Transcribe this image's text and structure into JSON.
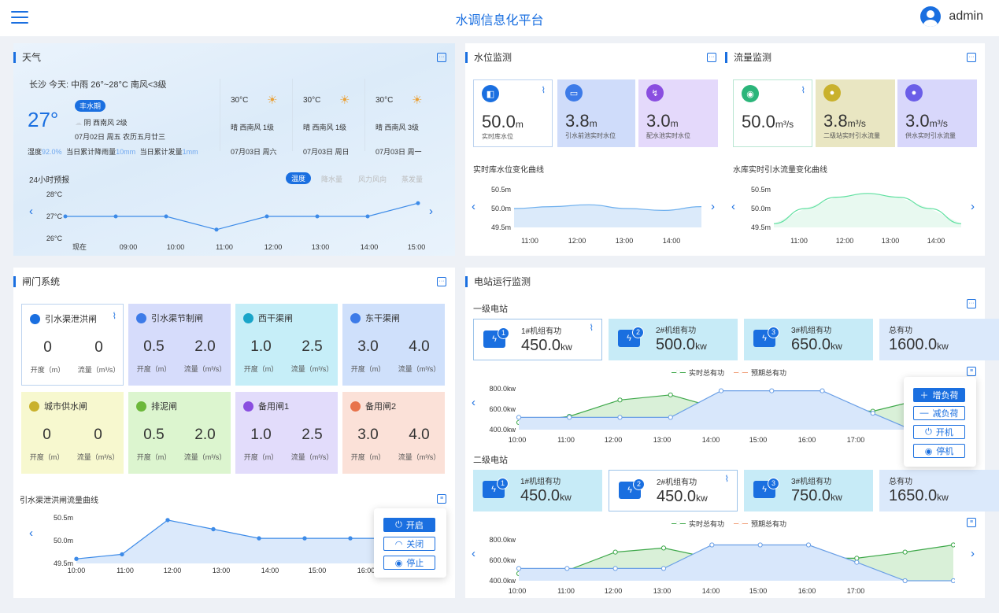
{
  "header": {
    "title": "水调信息化平台",
    "user": "admin"
  },
  "weather": {
    "title": "天气",
    "summary": "长沙 今天: 中雨 26°~28°C 南风<3级",
    "temp": "27°",
    "tag": "丰水期",
    "cond": "阴 西南风 2级",
    "date": "07月02日 周五 农历五月廿三",
    "humidity_label": "湿度",
    "humidity": "92.0%",
    "rain_label": "当日累计降雨量",
    "rain": "10mm",
    "evap_label": "当日累计发量",
    "evap": "1mm",
    "forecast": [
      {
        "temp": "30°C",
        "desc": "晴 西南风 1级",
        "date": "07月03日 周六"
      },
      {
        "temp": "30°C",
        "desc": "晴 西南风 1级",
        "date": "07月03日 周日"
      },
      {
        "temp": "30°C",
        "desc": "晴 西南风 3级",
        "date": "07月03日 周一"
      }
    ],
    "hourly_title": "24小时预报",
    "chips": [
      "温度",
      "降水量",
      "风力风向",
      "蒸发量"
    ]
  },
  "water_level": {
    "title": "水位监测",
    "cards": [
      {
        "value": "50.0",
        "unit": "m",
        "label": "实时库水位",
        "color": "#1a6fe0"
      },
      {
        "value": "3.8",
        "unit": "m",
        "label": "引水前池实时水位",
        "color": "#3d7be8"
      },
      {
        "value": "3.0",
        "unit": "m",
        "label": "配水池实时水位",
        "color": "#8a4ee0"
      }
    ],
    "chart_title": "实时库水位变化曲线"
  },
  "flow": {
    "title": "流量监测",
    "cards": [
      {
        "value": "50.0",
        "unit": "m³/s",
        "label": "",
        "color": "#2bb57a"
      },
      {
        "value": "3.8",
        "unit": "m³/s",
        "label": "二级站实时引水流量",
        "color": "#c9b12c"
      },
      {
        "value": "3.0",
        "unit": "m³/s",
        "label": "供水实时引水流量",
        "color": "#6b5ee8"
      }
    ],
    "chart_title": "水库实时引水流量变化曲线"
  },
  "gates": {
    "title": "闸门系统",
    "items": [
      {
        "name": "引水渠泄洪闸",
        "open": "0",
        "flow": "0",
        "color": "#1a6fe0"
      },
      {
        "name": "引水渠节制闸",
        "open": "0.5",
        "flow": "2.0",
        "color": "#3d7be8"
      },
      {
        "name": "西干渠闸",
        "open": "1.0",
        "flow": "2.5",
        "color": "#1aa5c9"
      },
      {
        "name": "东干渠闸",
        "open": "3.0",
        "flow": "4.0",
        "color": "#3d7be8"
      },
      {
        "name": "城市供水闸",
        "open": "0",
        "flow": "0",
        "color": "#c9b12c"
      },
      {
        "name": "排泥闸",
        "open": "0.5",
        "flow": "2.0",
        "color": "#6cb83a"
      },
      {
        "name": "备用闸1",
        "open": "1.0",
        "flow": "2.5",
        "color": "#8a4ee0"
      },
      {
        "name": "备用闸2",
        "open": "3.0",
        "flow": "4.0",
        "color": "#e8734b"
      }
    ],
    "open_label": "开度（m）",
    "flow_label": "流量（m³/s）",
    "chart_title": "引水渠泄洪闸流量曲线",
    "popup": [
      "开启",
      "关闭",
      "停止"
    ]
  },
  "power": {
    "title": "电站运行监测",
    "station1": {
      "title": "一级电站",
      "units": [
        {
          "name": "1#机组有功",
          "value": "450.0",
          "num": "1"
        },
        {
          "name": "2#机组有功",
          "value": "500.0",
          "num": "2"
        },
        {
          "name": "3#机组有功",
          "value": "650.0",
          "num": "3"
        },
        {
          "name": "总有功",
          "value": "1600.0",
          "num": ""
        }
      ]
    },
    "station2": {
      "title": "二级电站",
      "units": [
        {
          "name": "1#机组有功",
          "value": "450.0",
          "num": "1"
        },
        {
          "name": "2#机组有功",
          "value": "450.0",
          "num": "2"
        },
        {
          "name": "3#机组有功",
          "value": "750.0",
          "num": "3"
        },
        {
          "name": "总有功",
          "value": "1650.0",
          "num": ""
        }
      ]
    },
    "unit": "kw",
    "legend": [
      "实时总有功",
      "预期总有功"
    ],
    "popup": [
      "增负荷",
      "减负荷",
      "开机",
      "停机"
    ]
  },
  "chart_data": [
    {
      "type": "line",
      "title": "",
      "x": [
        "现在",
        "09:00",
        "10:00",
        "11:00",
        "12:00",
        "13:00",
        "14:00",
        "15:00"
      ],
      "series": [
        {
          "values": [
            27,
            27,
            27,
            26.4,
            27,
            27,
            27,
            27.6
          ]
        }
      ],
      "yticks": [
        "28°C",
        "27°C",
        "26°C"
      ],
      "ylim": [
        26,
        28
      ]
    },
    {
      "type": "area",
      "title": "实时库水位变化曲线",
      "x": [
        "11:00",
        "12:00",
        "13:00",
        "14:00"
      ],
      "series": [
        {
          "values": [
            50.0,
            50.05,
            50.1,
            50.0,
            49.95,
            50.05
          ]
        }
      ],
      "yticks": [
        "50.5m",
        "50.0m",
        "49.5m"
      ],
      "ylim": [
        49.5,
        50.5
      ]
    },
    {
      "type": "area",
      "title": "水库实时引水流量变化曲线",
      "x": [
        "11:00",
        "12:00",
        "13:00",
        "14:00"
      ],
      "series": [
        {
          "values": [
            49.6,
            50.0,
            50.3,
            50.4,
            50.3,
            50.0,
            49.6
          ]
        }
      ],
      "yticks": [
        "50.5m",
        "50.0m",
        "49.5m"
      ],
      "ylim": [
        49.5,
        50.5
      ]
    },
    {
      "type": "area",
      "title": "引水渠泄洪闸流量曲线",
      "x": [
        "10:00",
        "11:00",
        "12:00",
        "13:00",
        "14:00",
        "15:00",
        "16:00"
      ],
      "series": [
        {
          "values": [
            49.6,
            49.7,
            50.45,
            50.25,
            50.05,
            50.05,
            50.05,
            50.05
          ]
        }
      ],
      "yticks": [
        "50.5m",
        "50.0m",
        "49.5m"
      ],
      "ylim": [
        49.5,
        50.5
      ]
    },
    {
      "type": "line",
      "title": "",
      "x": [
        "10:00",
        "11:00",
        "12:00",
        "13:00",
        "14:00",
        "15:00",
        "16:00",
        "17:00"
      ],
      "series": [
        {
          "name": "实时总有功",
          "values": [
            470,
            530,
            690,
            740,
            600,
            600,
            600,
            580,
            700
          ]
        },
        {
          "name": "预期总有功",
          "values": [
            520,
            520,
            520,
            520,
            780,
            780,
            780,
            560,
            350
          ]
        }
      ],
      "yticks": [
        "800.0kw",
        "600.0kw",
        "400.0kw"
      ],
      "ylim": [
        400,
        800
      ]
    },
    {
      "type": "line",
      "title": "",
      "x": [
        "10:00",
        "11:00",
        "12:00",
        "13:00",
        "14:00",
        "15:00",
        "16:00",
        "17:00"
      ],
      "series": [
        {
          "name": "实时总有功",
          "values": [
            470,
            500,
            680,
            720,
            620,
            620,
            620,
            620,
            680,
            750
          ]
        },
        {
          "name": "预期总有功",
          "values": [
            520,
            520,
            520,
            520,
            750,
            750,
            750,
            580,
            400,
            400
          ]
        }
      ],
      "yticks": [
        "800.0kw",
        "600.0kw",
        "400.0kw"
      ],
      "ylim": [
        400,
        800
      ]
    }
  ]
}
